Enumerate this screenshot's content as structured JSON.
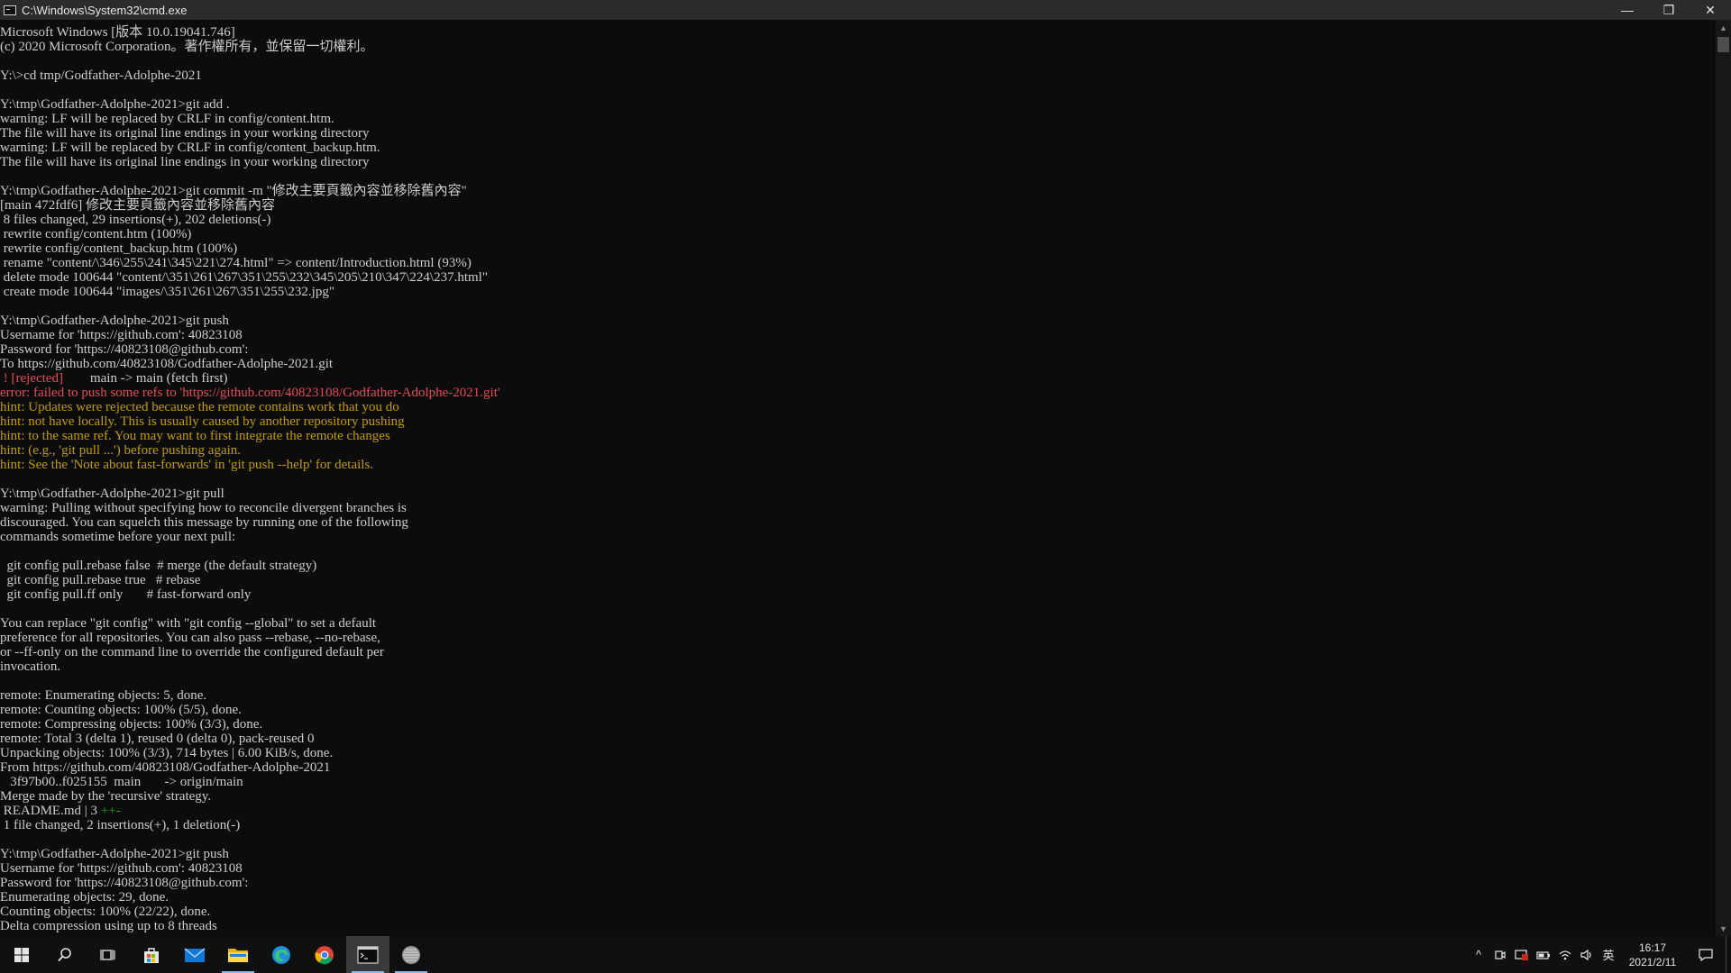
{
  "window": {
    "title": "C:\\Windows\\System32\\cmd.exe",
    "minimize": "—",
    "restore": "❐",
    "close": "✕"
  },
  "console": {
    "lines": [
      [
        {
          "t": "Microsoft Windows [版本 10.0.19041.746]"
        }
      ],
      [
        {
          "t": "(c) 2020 Microsoft Corporation。著作權所有，並保留一切權利。"
        }
      ],
      [
        {
          "t": ""
        }
      ],
      [
        {
          "t": "Y:\\>cd tmp/Godfather-Adolphe-2021"
        }
      ],
      [
        {
          "t": ""
        }
      ],
      [
        {
          "t": "Y:\\tmp\\Godfather-Adolphe-2021>git add ."
        }
      ],
      [
        {
          "t": "warning: LF will be replaced by CRLF in config/content.htm."
        }
      ],
      [
        {
          "t": "The file will have its original line endings in your working directory"
        }
      ],
      [
        {
          "t": "warning: LF will be replaced by CRLF in config/content_backup.htm."
        }
      ],
      [
        {
          "t": "The file will have its original line endings in your working directory"
        }
      ],
      [
        {
          "t": ""
        }
      ],
      [
        {
          "t": "Y:\\tmp\\Godfather-Adolphe-2021>git commit -m \"修改主要頁籤內容並移除舊內容\""
        }
      ],
      [
        {
          "t": "[main 472fdf6] 修改主要頁籤內容並移除舊內容"
        }
      ],
      [
        {
          "t": " 8 files changed, 29 insertions(+), 202 deletions(-)"
        }
      ],
      [
        {
          "t": " rewrite config/content.htm (100%)"
        }
      ],
      [
        {
          "t": " rewrite config/content_backup.htm (100%)"
        }
      ],
      [
        {
          "t": " rename \"content/\\346\\255\\241\\345\\221\\274.html\" => content/Introduction.html (93%)"
        }
      ],
      [
        {
          "t": " delete mode 100644 \"content/\\351\\261\\267\\351\\255\\232\\345\\205\\210\\347\\224\\237.html\""
        }
      ],
      [
        {
          "t": " create mode 100644 \"images/\\351\\261\\267\\351\\255\\232.jpg\""
        }
      ],
      [
        {
          "t": ""
        }
      ],
      [
        {
          "t": "Y:\\tmp\\Godfather-Adolphe-2021>git push"
        }
      ],
      [
        {
          "t": "Username for 'https://github.com': 40823108"
        }
      ],
      [
        {
          "t": "Password for 'https://40823108@github.com':"
        }
      ],
      [
        {
          "t": "To https://github.com/40823108/Godfather-Adolphe-2021.git"
        }
      ],
      [
        {
          "t": " ! [rejected]",
          "c": "red"
        },
        {
          "t": "        main -> main (fetch first)"
        }
      ],
      [
        {
          "t": "error: failed to push some refs to 'https://github.com/40823108/Godfather-Adolphe-2021.git'",
          "c": "red"
        }
      ],
      [
        {
          "t": "hint: Updates were rejected because the remote contains work that you do",
          "c": "yellow"
        }
      ],
      [
        {
          "t": "hint: not have locally. This is usually caused by another repository pushing",
          "c": "yellow"
        }
      ],
      [
        {
          "t": "hint: to the same ref. You may want to first integrate the remote changes",
          "c": "yellow"
        }
      ],
      [
        {
          "t": "hint: (e.g., 'git pull ...') before pushing again.",
          "c": "yellow"
        }
      ],
      [
        {
          "t": "hint: See the 'Note about fast-forwards' in 'git push --help' for details.",
          "c": "yellow"
        }
      ],
      [
        {
          "t": ""
        }
      ],
      [
        {
          "t": "Y:\\tmp\\Godfather-Adolphe-2021>git pull"
        }
      ],
      [
        {
          "t": "warning: Pulling without specifying how to reconcile divergent branches is"
        }
      ],
      [
        {
          "t": "discouraged. You can squelch this message by running one of the following"
        }
      ],
      [
        {
          "t": "commands sometime before your next pull:"
        }
      ],
      [
        {
          "t": ""
        }
      ],
      [
        {
          "t": "  git config pull.rebase false  # merge (the default strategy)"
        }
      ],
      [
        {
          "t": "  git config pull.rebase true   # rebase"
        }
      ],
      [
        {
          "t": "  git config pull.ff only       # fast-forward only"
        }
      ],
      [
        {
          "t": ""
        }
      ],
      [
        {
          "t": "You can replace \"git config\" with \"git config --global\" to set a default"
        }
      ],
      [
        {
          "t": "preference for all repositories. You can also pass --rebase, --no-rebase,"
        }
      ],
      [
        {
          "t": "or --ff-only on the command line to override the configured default per"
        }
      ],
      [
        {
          "t": "invocation."
        }
      ],
      [
        {
          "t": ""
        }
      ],
      [
        {
          "t": "remote: Enumerating objects: 5, done."
        }
      ],
      [
        {
          "t": "remote: Counting objects: 100% (5/5), done."
        }
      ],
      [
        {
          "t": "remote: Compressing objects: 100% (3/3), done."
        }
      ],
      [
        {
          "t": "remote: Total 3 (delta 1), reused 0 (delta 0), pack-reused 0"
        }
      ],
      [
        {
          "t": "Unpacking objects: 100% (3/3), 714 bytes | 6.00 KiB/s, done."
        }
      ],
      [
        {
          "t": "From https://github.com/40823108/Godfather-Adolphe-2021"
        }
      ],
      [
        {
          "t": "   3f97b00..f025155  main       -> origin/main"
        }
      ],
      [
        {
          "t": "Merge made by the 'recursive' strategy."
        }
      ],
      [
        {
          "t": " README.md | 3 "
        },
        {
          "t": "++",
          "c": "green"
        },
        {
          "t": "-",
          "c": "red"
        }
      ],
      [
        {
          "t": " 1 file changed, 2 insertions(+), 1 deletion(-)"
        }
      ],
      [
        {
          "t": ""
        }
      ],
      [
        {
          "t": "Y:\\tmp\\Godfather-Adolphe-2021>git push"
        }
      ],
      [
        {
          "t": "Username for 'https://github.com': 40823108"
        }
      ],
      [
        {
          "t": "Password for 'https://40823108@github.com':"
        }
      ],
      [
        {
          "t": "Enumerating objects: 29, done."
        }
      ],
      [
        {
          "t": "Counting objects: 100% (22/22), done."
        }
      ],
      [
        {
          "t": "Delta compression using up to 8 threads"
        }
      ]
    ]
  },
  "taskbar": {
    "apps": [
      {
        "name": "start-button",
        "icon": "windows-logo-icon",
        "interactable": true
      },
      {
        "name": "search-button",
        "icon": "search-icon",
        "interactable": true
      },
      {
        "name": "task-view-button",
        "icon": "task-view-icon",
        "interactable": true
      },
      {
        "name": "taskbar-store",
        "icon": "store-icon",
        "interactable": true
      },
      {
        "name": "taskbar-mail",
        "icon": "mail-icon",
        "interactable": true
      },
      {
        "name": "taskbar-file-explorer",
        "icon": "folder-icon",
        "interactable": true,
        "running": true
      },
      {
        "name": "taskbar-edge",
        "icon": "edge-icon",
        "interactable": true
      },
      {
        "name": "taskbar-chrome",
        "icon": "chrome-icon",
        "interactable": true
      },
      {
        "name": "taskbar-cmd",
        "icon": "cmd-icon",
        "interactable": true,
        "running": true,
        "active": true
      },
      {
        "name": "taskbar-app",
        "icon": "app-orb-icon",
        "interactable": true,
        "running": true
      }
    ],
    "tray": {
      "chevron": "^",
      "ime": "英",
      "time": "16:17",
      "date": "2021/2/11"
    }
  },
  "colors": {
    "console_bg": "#0c0c0c",
    "console_fg": "#cccccc",
    "error_red": "#e74856",
    "hint_yellow": "#c19c00",
    "diff_green": "#13a10e",
    "accent": "#8fb9e8"
  }
}
